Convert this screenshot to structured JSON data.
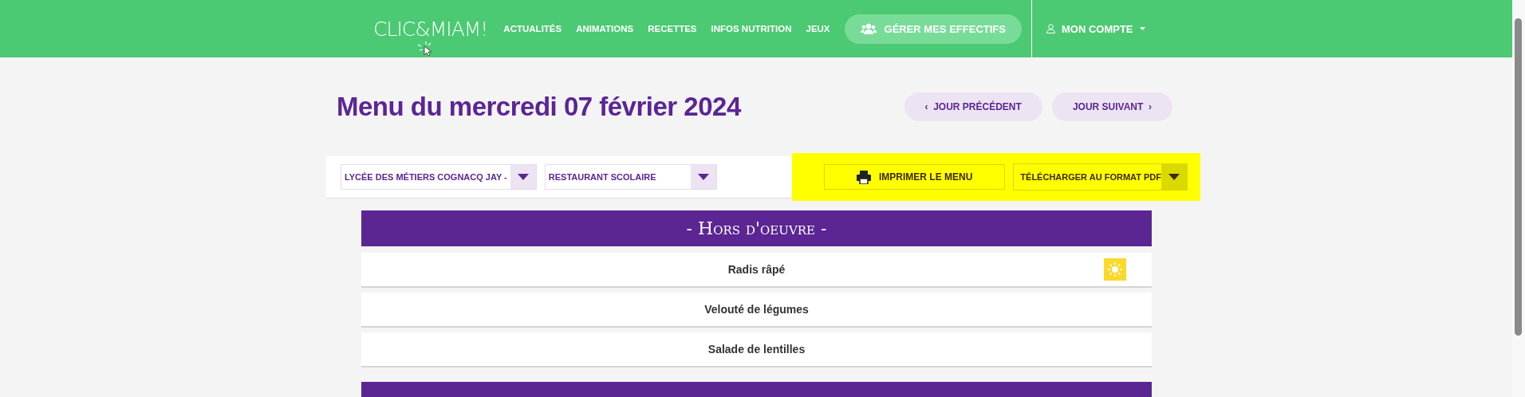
{
  "header": {
    "logo": "CLIC&MIAM!",
    "nav": [
      {
        "label": "ACTUALITÉS"
      },
      {
        "label": "ANIMATIONS"
      },
      {
        "label": "RECETTES"
      },
      {
        "label": "INFOS NUTRITION"
      },
      {
        "label": "JEUX"
      }
    ],
    "manage_button": "GÉRER MES EFFECTIFS",
    "account": "MON COMPTE"
  },
  "title": "Menu du mercredi 07 février 2024",
  "day_buttons": [
    {
      "label": "‹  JOUR PRÉCÉDENT"
    },
    {
      "label": "JOUR SUIVANT  ›"
    }
  ],
  "filters": [
    {
      "value": "LYCÉE DES MÉTIERS COGNACQ JAY -"
    },
    {
      "value": "RESTAURANT SCOLAIRE"
    }
  ],
  "print_button": "IMPRIMER LE MENU",
  "download": {
    "value": "TÉLÉCHARGER AU FORMAT PDF"
  },
  "sections": [
    {
      "title": "- Hors d'oeuvre -",
      "items": [
        {
          "name": "Radis râpé",
          "seasonal": true
        },
        {
          "name": "Velouté de légumes",
          "seasonal": false
        },
        {
          "name": "Salade de lentilles",
          "seasonal": false
        }
      ]
    },
    {
      "kind": "cut-off"
    }
  ]
}
